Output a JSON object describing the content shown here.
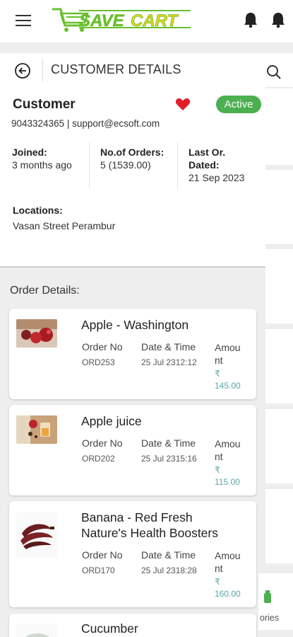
{
  "app": {
    "logo_text": "SAVECART"
  },
  "header": {
    "title": "CUSTOMER DETAILS"
  },
  "customer": {
    "title": "Customer",
    "status": "Active",
    "contact": "9043324365 | support@ecsoft.com",
    "joined_label": "Joined:",
    "joined_value": "3 months ago",
    "orders_label": "No.of Orders:",
    "orders_value": "5 (1539.00)",
    "last_label_1": "Last Or.",
    "last_label_2": "Dated:",
    "last_value": "21 Sep 2023",
    "locations_label": "Locations:",
    "locations_value": "Vasan Street Perambur"
  },
  "orders": {
    "section_label": "Order Details:",
    "col_order": "Order No",
    "col_date": "Date & Time",
    "col_amount_1": "Amou",
    "col_amount_2": "nt",
    "items": [
      {
        "name": "Apple - Washington",
        "order_no": "ORD253",
        "datetime": "25 Jul 2312:12",
        "currency": "₹",
        "amount": "145.00"
      },
      {
        "name": "Apple juice",
        "order_no": "ORD202",
        "datetime": "25 Jul 2315:16",
        "currency": "₹",
        "amount": "115.00"
      },
      {
        "name_1": "Banana - Red Fresh",
        "name_2": "Nature's Health Boosters",
        "order_no": "ORD170",
        "datetime": "25 Jul 2318:28",
        "currency": "₹",
        "amount": "160.00"
      },
      {
        "name": "Cucumber"
      }
    ]
  },
  "background": {
    "side_label": "ories"
  },
  "colors": {
    "brand_green": "#4caf50",
    "logo_green": "#6abf2e",
    "logo_yellow": "#e8d21c",
    "heart": "#e11d2a",
    "amount": "#5aa5a8"
  }
}
